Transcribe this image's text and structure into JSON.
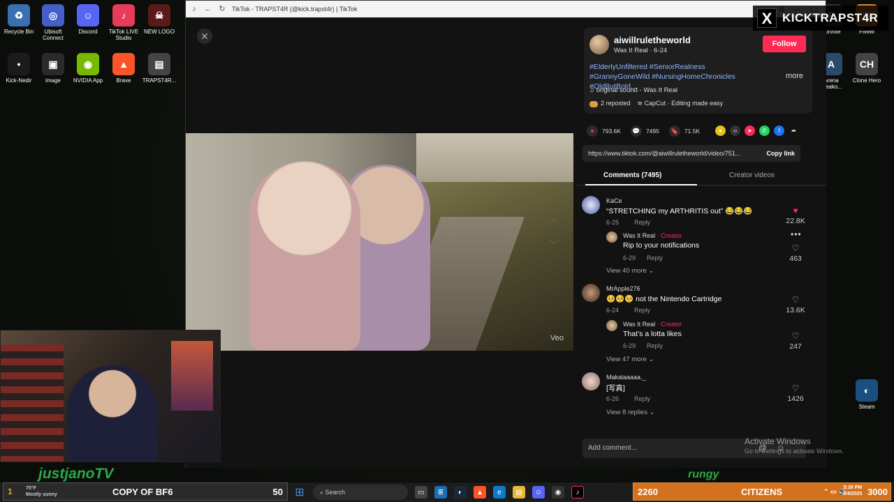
{
  "desktop": {
    "icons_left": [
      {
        "label": "Recycle Bin",
        "color": "#3a6fb0",
        "glyph": "♻"
      },
      {
        "label": "Ubisoft Connect",
        "color": "#4460c8",
        "glyph": "◎"
      },
      {
        "label": "Discord",
        "color": "#5865f2",
        "glyph": "☺"
      },
      {
        "label": "TikTok LIVE Studio",
        "color": "#e83a5a",
        "glyph": "♪"
      },
      {
        "label": "NEW LOGO",
        "color": "#5a1a1a",
        "glyph": "☠"
      },
      {
        "label": "Kick-Nedir",
        "color": "#1b1b1b",
        "glyph": "•"
      },
      {
        "label": "image",
        "color": "#2a2a2a",
        "glyph": "▣"
      },
      {
        "label": "NVIDIA App",
        "color": "#76b900",
        "glyph": "◉"
      },
      {
        "label": "Brave",
        "color": "#fb542b",
        "glyph": "▲"
      },
      {
        "label": "TRAPST4R...",
        "color": "#444",
        "glyph": "▤"
      }
    ],
    "icons_right": [
      {
        "label": "Fortnite",
        "color": "#333",
        "glyph": "F"
      },
      {
        "label": "FiveM",
        "color": "#e0852a",
        "glyph": "5"
      },
      {
        "label": "Arena Breako...",
        "color": "#2b4a6b",
        "glyph": "A"
      },
      {
        "label": "Clone Hero",
        "color": "#444",
        "glyph": "CH"
      },
      {
        "label": "Steam",
        "color": "#1b4f80",
        "glyph": "◐"
      }
    ]
  },
  "browser": {
    "title": "TikTok - TRAPST4R (@kick.trapst4r) | TikTok",
    "veo_label": "Veo"
  },
  "post": {
    "username": "aiwillruletheworld",
    "subtitle": "Was It Real · 6-24",
    "follow_label": "Follow",
    "hashtags": "#ElderlyUnfiltered #SeniorRealness #GrannyGoneWild #NursingHomeChronicles #OldButBold...",
    "more_label": "more",
    "sound": "original sound - Was It Real",
    "reposted": "2 reposted",
    "capcut": "CapCut · Editing made easy",
    "likes": "793.6K",
    "comments": "7495",
    "saves": "71.5K",
    "link": "https://www.tiktok.com/@aiwillruletheworld/video/751...",
    "copy_label": "Copy link",
    "tab_comments": "Comments (7495)",
    "tab_creator": "Creator videos",
    "add_comment_placeholder": "Add comment..."
  },
  "comments": [
    {
      "name": "KaCe",
      "text": "“STRETCHING my ARTHRITIS out” 😂😂😂",
      "date": "6-25",
      "reply": "Reply",
      "likes": "22.8K",
      "liked": true
    },
    {
      "name": "Was It Real",
      "creator": "· Creator",
      "text": "Rip to your notifications",
      "date": "6-29",
      "reply": "Reply",
      "likes": "463"
    },
    {
      "view_more": "View 40 more ⌄"
    },
    {
      "name": "MrApple276",
      "text": "🥺🥺🥺 not the Nintendo Cartridge",
      "date": "6-24",
      "reply": "Reply",
      "likes": "13.6K"
    },
    {
      "name": "Was It Real",
      "creator": "· Creator",
      "text": "That’s a lotta likes",
      "date": "6-29",
      "reply": "Reply",
      "likes": "247"
    },
    {
      "view_more": "View 47 more ⌄"
    },
    {
      "name": "Makalaaaaa._",
      "text": "[写真]",
      "date": "6-26",
      "reply": "Reply",
      "likes": "1426"
    },
    {
      "view_more": "View 8 replies ⌄"
    }
  ],
  "overlay": {
    "x_handle": "KICKTRAPST4R",
    "activate_title": "Activate Windows",
    "activate_sub": "Go to Settings to activate Windows.",
    "streamer_left": "justjanoTV",
    "streamer_right": "rungy"
  },
  "bottom": {
    "left_num": "1",
    "weather_temp": "75°F",
    "weather_desc": "Mostly sunny",
    "left_title": "COPY OF BF6",
    "left_count": "50",
    "search": "Search",
    "right_num": "2260",
    "right_title": "CITIZENS",
    "right_count": "3000",
    "time": "5:26 PM",
    "date": "8/4/2025"
  }
}
